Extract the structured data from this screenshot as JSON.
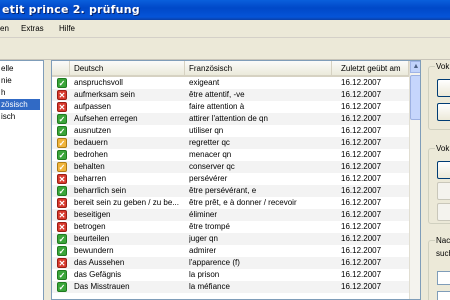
{
  "window": {
    "title": "etit prince 2. prüfung"
  },
  "menu": [
    {
      "label": "en"
    },
    {
      "label": "Extras"
    },
    {
      "label": "Hilfe"
    }
  ],
  "tree": [
    {
      "label": "elle"
    },
    {
      "label": "nie"
    },
    {
      "label": "h"
    },
    {
      "label": "zösisch",
      "selected": true
    },
    {
      "label": "isch"
    }
  ],
  "grid": {
    "columns": [
      "Deutsch",
      "Französisch",
      "Zuletzt geübt am"
    ],
    "rows": [
      {
        "status": "ok",
        "de": "anspruchsvoll",
        "fr": "exigeant",
        "date": "16.12.2007"
      },
      {
        "status": "bad",
        "de": "aufmerksam sein",
        "fr": "être attentif, -ve",
        "date": "16.12.2007"
      },
      {
        "status": "bad",
        "de": "aufpassen",
        "fr": "faire attention à",
        "date": "16.12.2007"
      },
      {
        "status": "ok",
        "de": "Aufsehen erregen",
        "fr": "attirer l'attention de qn",
        "date": "16.12.2007"
      },
      {
        "status": "ok",
        "de": "ausnutzen",
        "fr": "utiliser qn",
        "date": "16.12.2007"
      },
      {
        "status": "mid",
        "de": "bedauern",
        "fr": "regretter qc",
        "date": "16.12.2007"
      },
      {
        "status": "ok",
        "de": "bedrohen",
        "fr": "menacer qn",
        "date": "16.12.2007"
      },
      {
        "status": "mid",
        "de": "behalten",
        "fr": "conserver qc",
        "date": "16.12.2007"
      },
      {
        "status": "bad",
        "de": "beharren",
        "fr": "persévérer",
        "date": "16.12.2007"
      },
      {
        "status": "ok",
        "de": "beharrlich sein",
        "fr": "être persévérant, e",
        "date": "16.12.2007"
      },
      {
        "status": "bad",
        "de": "bereit sein zu geben / zu be...",
        "fr": "être prêt, e à donner / recevoir",
        "date": "16.12.2007"
      },
      {
        "status": "bad",
        "de": "beseitigen",
        "fr": "éliminer",
        "date": "16.12.2007"
      },
      {
        "status": "bad",
        "de": "betrogen",
        "fr": "être trompé",
        "date": "16.12.2007"
      },
      {
        "status": "ok",
        "de": "beurteilen",
        "fr": "juger qn",
        "date": "16.12.2007"
      },
      {
        "status": "ok",
        "de": "bewundern",
        "fr": "admirer",
        "date": "16.12.2007"
      },
      {
        "status": "bad",
        "de": "das Aussehen",
        "fr": "l'apparence (f)",
        "date": "16.12.2007"
      },
      {
        "status": "ok",
        "de": "das Gefägnis",
        "fr": "la prison",
        "date": "16.12.2007"
      },
      {
        "status": "ok",
        "de": "Das Misstrauen",
        "fr": "la méfiance",
        "date": "16.12.2007"
      }
    ]
  },
  "right_panel": {
    "group1_label": "Vok",
    "group2_label": "Vok",
    "group3_label": "Nac",
    "group3_sub": "such"
  },
  "icons": {
    "ok": "check-icon",
    "bad": "cross-icon",
    "mid": "partial-icon"
  }
}
